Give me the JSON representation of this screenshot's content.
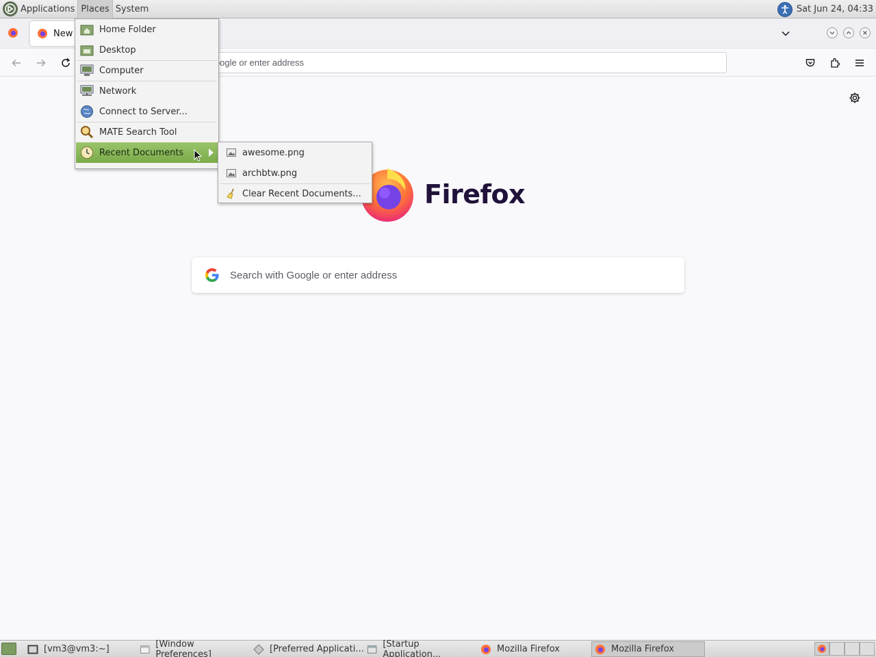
{
  "top_panel": {
    "menus": [
      "Applications",
      "Places",
      "System"
    ],
    "clock": "Sat Jun 24, 04:33"
  },
  "browser": {
    "tab_title": "New T",
    "url_placeholder": "n Google or enter address",
    "brand_name": "Firefox",
    "search_placeholder": "Search with Google or enter address"
  },
  "places_menu": {
    "items": [
      {
        "label": "Home Folder",
        "icon": "home-folder-icon"
      },
      {
        "label": "Desktop",
        "icon": "desktop-icon"
      },
      {
        "label": "Computer",
        "icon": "computer-icon"
      },
      {
        "label": "Network",
        "icon": "network-icon"
      },
      {
        "label": "Connect to Server...",
        "icon": "globe-icon"
      },
      {
        "label": "MATE Search Tool",
        "icon": "magnifier-icon"
      },
      {
        "label": "Recent Documents",
        "icon": "clock-icon"
      }
    ],
    "highlight_color": "#86b555"
  },
  "recent_menu": {
    "items": [
      {
        "label": "awesome.png",
        "icon": "image-file-icon"
      },
      {
        "label": "archbtw.png",
        "icon": "image-file-icon"
      },
      {
        "label": "Clear Recent Documents...",
        "icon": "broom-icon"
      }
    ]
  },
  "taskbar": {
    "tasks": [
      {
        "label": "[vm3@vm3:~]",
        "icon": "terminal-icon"
      },
      {
        "label": "[Window Preferences]",
        "icon": "window-icon"
      },
      {
        "label": "[Preferred Applicati...",
        "icon": "preferences-icon"
      },
      {
        "label": "[Startup Application...",
        "icon": "window-icon"
      },
      {
        "label": "Mozilla Firefox",
        "icon": "firefox-icon"
      },
      {
        "label": "Mozilla Firefox",
        "icon": "firefox-icon"
      }
    ]
  }
}
